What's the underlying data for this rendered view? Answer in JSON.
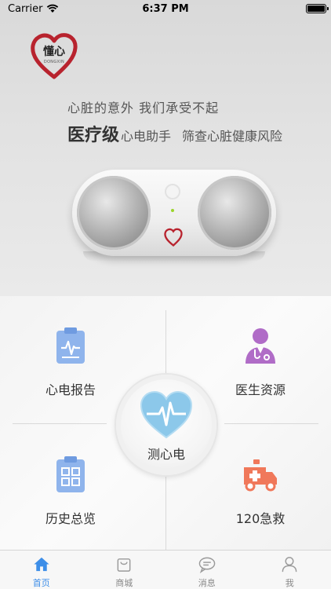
{
  "status_bar": {
    "carrier": "Carrier",
    "time": "6:37 PM"
  },
  "hero": {
    "logo_text": "懂心",
    "logo_subtext": "DONGXIN",
    "slogan_line1": "心脏的意外  我们承受不起",
    "slogan_line2_strong": "医疗级",
    "slogan_line2_rest": "心电助手",
    "slogan_line2_tail": "筛查心脏健康风险"
  },
  "menu": {
    "ecg_report": "心电报告",
    "doctor_resources": "医生资源",
    "history_overview": "历史总览",
    "emergency_120": "120急救",
    "measure_ecg": "测心电"
  },
  "tabbar": {
    "tabs": [
      {
        "label": "首页",
        "icon": "home-icon",
        "active": true
      },
      {
        "label": "商城",
        "icon": "shopping-bag-icon",
        "active": false
      },
      {
        "label": "消息",
        "icon": "chat-bubble-icon",
        "active": false
      },
      {
        "label": "我",
        "icon": "person-icon",
        "active": false
      }
    ]
  },
  "colors": {
    "accent": "#3d8ee8",
    "brand_red": "#b8232e",
    "icon_blue": "#8fb4ec",
    "icon_purple": "#b06cc7",
    "icon_orange": "#f0785a",
    "heart_blue": "#8cc8ea"
  }
}
